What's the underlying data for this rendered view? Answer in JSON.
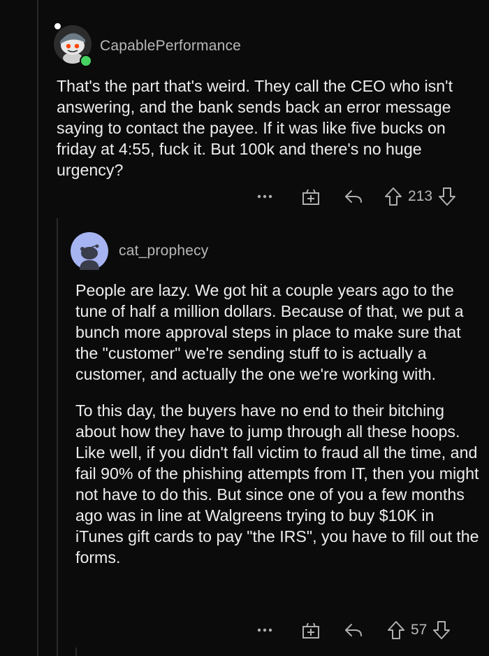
{
  "comments": [
    {
      "username": "CapablePerformance",
      "avatar_icon": "snoo-avatar-icon",
      "online": true,
      "paragraphs": [
        "That's the part that's weird. They call the CEO who isn't answering, and the bank sends back an error message saying to contact the payee. If it was like five bucks on friday at 4:55, fuck it. But 100k and there's no huge urgency?"
      ],
      "score": "213"
    },
    {
      "username": "cat_prophecy",
      "avatar_icon": "snoo-avatar-icon",
      "paragraphs": [
        "People are lazy. We got hit a couple years ago to the tune of half a million dollars. Because of that, we put a bunch more approval steps in place to make sure that the \"customer\" we're sending stuff to is actually a customer, and actually the one we're working with.",
        "To this day, the buyers have no end to their bitching about how they have to jump through all these hoops. Like well, if you didn't fall victim to fraud all the time, and fail 90% of the phishing attempts from IT, then you might not have to do this. But since one of you a few months ago was in line at Walgreens trying to buy $10K in iTunes gift cards to pay \"the IRS\", you have to fill out the forms."
      ],
      "score": "57"
    }
  ],
  "colors": {
    "background": "#0b0b0b",
    "thread_line": "#2a2a2a",
    "text": "#ededed",
    "meta": "#b8b8b8",
    "online": "#46d160",
    "avatar2_bg": "#a6b4f2"
  }
}
